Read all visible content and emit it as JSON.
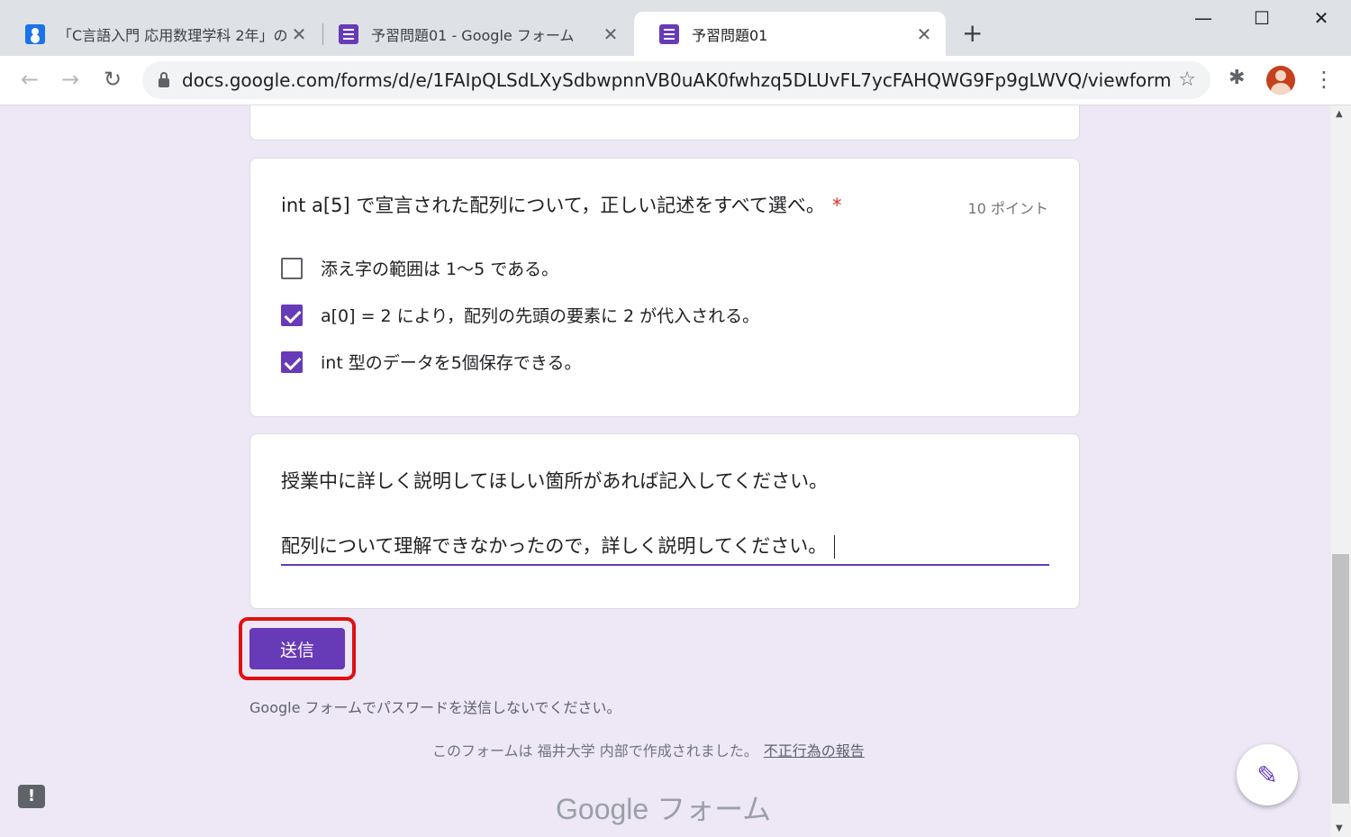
{
  "tabs": [
    {
      "title": "「C言語入門 応用数理学科 2年」の",
      "icon": "classroom-icon",
      "active": false
    },
    {
      "title": "予習問題01 - Google フォーム",
      "icon": "forms-icon",
      "active": false
    },
    {
      "title": "予習問題01",
      "icon": "forms-icon",
      "active": true
    }
  ],
  "window_controls": {
    "minimize": "—",
    "maximize": "☐",
    "close": "✕"
  },
  "toolbar": {
    "url": "docs.google.com/forms/d/e/1FAIpQLSdLXySdbwpnnVB0uAK0fwhzq5DLUvFL7ycFAHQWG9Fp9gLWVQ/viewform"
  },
  "question": {
    "title": "int a[5] で宣言された配列について，正しい記述をすべて選べ。",
    "required_mark": "*",
    "points": "10 ポイント",
    "options": [
      {
        "label": "添え字の範囲は 1～5 である。",
        "checked": false
      },
      {
        "label": "a[0] = 2 により，配列の先頭の要素に 2 が代入される。",
        "checked": true
      },
      {
        "label": "int 型のデータを5個保存できる。",
        "checked": true
      }
    ]
  },
  "text_question": {
    "title": "授業中に詳しく説明してほしい箇所があれば記入してください。",
    "value": "配列について理解できなかったので，詳しく説明してください。"
  },
  "submit_label": "送信",
  "password_note": "Google フォームでパスワードを送信しないでください。",
  "footer": {
    "created_by": "このフォームは 福井大学 内部で作成されました。",
    "report_link": "不正行為の報告",
    "brand": "Google フォーム"
  },
  "colors": {
    "accent": "#673ab7",
    "background": "#ede7f6",
    "highlight": "#e01010"
  }
}
